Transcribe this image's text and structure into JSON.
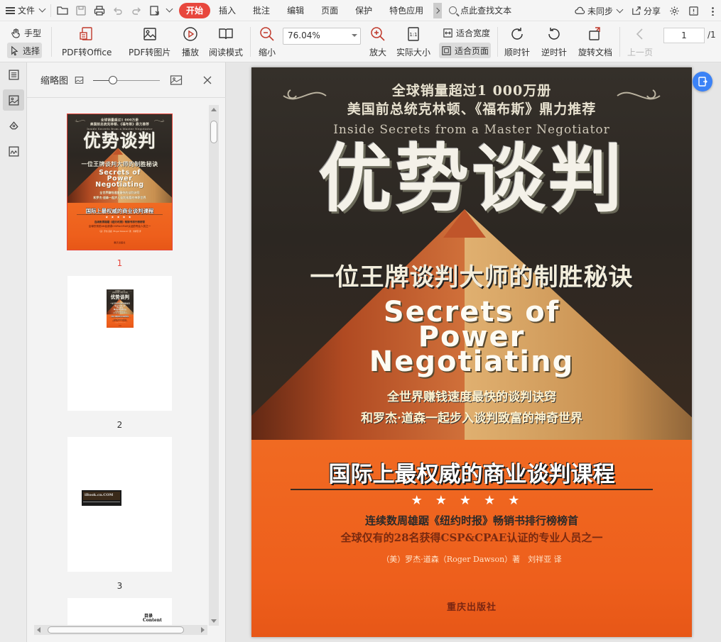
{
  "menubar": {
    "file_label": "文件",
    "tabs": [
      "开始",
      "插入",
      "批注",
      "编辑",
      "页面",
      "保护",
      "特色应用"
    ],
    "active_tab": "开始",
    "search_label": "点此查找文本",
    "sync_label": "未同步",
    "share_label": "分享"
  },
  "toolbar": {
    "hand": "手型",
    "select": "选择",
    "pdf_office": "PDF转Office",
    "pdf_image": "PDF转图片",
    "play": "播放",
    "read_mode": "阅读模式",
    "zoom_out": "缩小",
    "zoom_value": "76.04%",
    "zoom_in": "放大",
    "actual_size": "实际大小",
    "fit_width": "适合宽度",
    "fit_page": "适合页面",
    "rotate_cw": "顺时针",
    "rotate_ccw": "逆时针",
    "rotate_doc": "旋转文档",
    "prev_page": "上一页",
    "page_current": "1",
    "page_total": "/1"
  },
  "thumbpanel": {
    "title": "缩略图",
    "slider_fraction": 0.3,
    "pages": [
      {
        "num": "1",
        "selected": true
      },
      {
        "num": "2",
        "selected": false
      },
      {
        "num": "3",
        "selected": false
      }
    ],
    "page3_text": "iBook.cn.COM",
    "page4_text1": "目录",
    "page4_text2": "Content"
  },
  "cover": {
    "top_line1": "全球销量超过1 000万册",
    "top_line2": "美国前总统克林顿、《福布斯》鼎力推荐",
    "english_title": "Inside Secrets from a Master Negotiator",
    "main_title": "优势谈判",
    "subtitle": "一位王牌谈判大师的制胜秘诀",
    "en_line1": "Secrets of",
    "en_line2": "Power",
    "en_line3": "Negotiating",
    "mid_line1": "全世界赚钱速度最快的谈判诀窍",
    "mid_line2": "和罗杰·道森一起步入谈判致富的神奇世界",
    "course": "国际上最权威的商业谈判课程",
    "stars": "★★★★★",
    "line1": "连续数周雄踞《纽约时报》畅销书排行榜榜首",
    "line2": "全球仅有的28名获得CSP&CPAE认证的专业人员之一",
    "authors": "（美）罗杰·道森（Roger Dawson）著　刘祥亚 译",
    "publisher": "重庆出版社"
  },
  "colors": {
    "accent": "#e8473d",
    "float_button": "#3b82f6",
    "cover_orange": "#f06a22"
  }
}
